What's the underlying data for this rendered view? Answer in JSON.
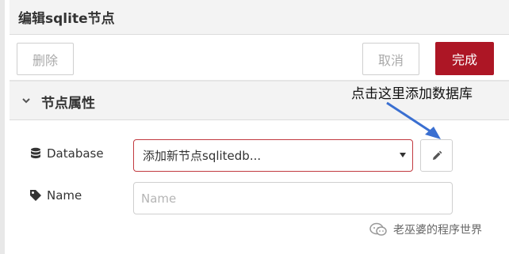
{
  "header": {
    "title": "编辑sqlite节点"
  },
  "toolbar": {
    "delete_label": "删除",
    "cancel_label": "取消",
    "done_label": "完成"
  },
  "section": {
    "title": "节点属性",
    "expanded": true
  },
  "annotation": {
    "text": "点击这里添加数据库"
  },
  "form": {
    "database": {
      "label": "Database",
      "icon": "database-icon",
      "selected_value": "添加新节点sqlitedb..."
    },
    "name": {
      "label": "Name",
      "icon": "tag-icon",
      "value": "",
      "placeholder": "Name"
    }
  },
  "watermark": {
    "text": "老巫婆的程序世界"
  },
  "colors": {
    "done_button": "#ad1625",
    "select_border": "#c23a40",
    "annotation_arrow": "#3a6fd1"
  }
}
